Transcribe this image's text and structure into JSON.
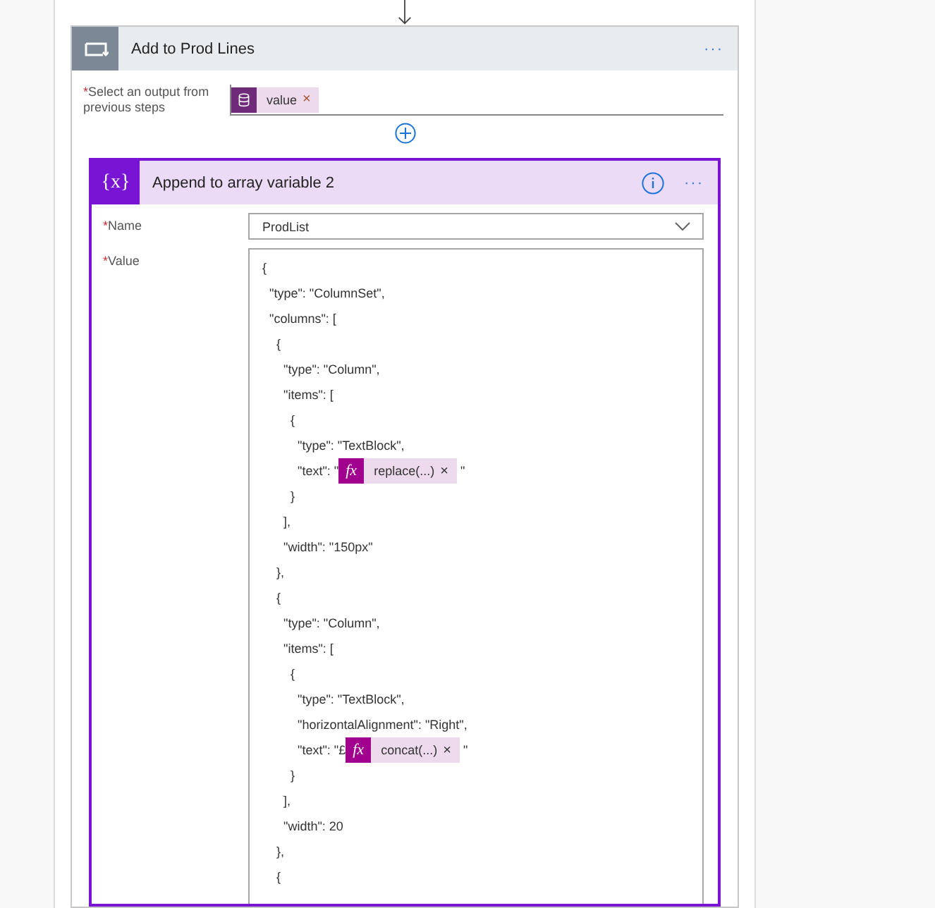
{
  "loop": {
    "title": "Add to Prod Lines",
    "more": "···",
    "field": {
      "marker": "*",
      "label": "Select an output from previous steps",
      "token": {
        "label": "value",
        "close": "×"
      }
    }
  },
  "action": {
    "icon_text": "{x}",
    "title": "Append to array variable 2",
    "more": "···",
    "fields": [
      {
        "kind": "dropdown",
        "marker": "*",
        "label": "Name",
        "value": "ProdList"
      },
      {
        "kind": "code",
        "marker": "*",
        "label": "Value"
      }
    ],
    "code_lines": [
      {
        "segments": [
          {
            "kind": "text",
            "text": "{"
          }
        ]
      },
      {
        "segments": [
          {
            "kind": "text",
            "text": "  \"type\": \"ColumnSet\","
          }
        ]
      },
      {
        "segments": [
          {
            "kind": "text",
            "text": "  \"columns\": ["
          }
        ]
      },
      {
        "segments": [
          {
            "kind": "text",
            "text": "    {"
          }
        ]
      },
      {
        "segments": [
          {
            "kind": "text",
            "text": "      \"type\": \"Column\","
          }
        ]
      },
      {
        "segments": [
          {
            "kind": "text",
            "text": "      \"items\": ["
          }
        ]
      },
      {
        "segments": [
          {
            "kind": "text",
            "text": "        {"
          }
        ]
      },
      {
        "segments": [
          {
            "kind": "text",
            "text": "          \"type\": \"TextBlock\","
          }
        ]
      },
      {
        "segments": [
          {
            "kind": "text",
            "text": "          \"text\": \""
          },
          {
            "kind": "token",
            "icon_text": "fx",
            "label": "replace(...)",
            "close": "×"
          },
          {
            "kind": "text",
            "text": " \""
          }
        ]
      },
      {
        "segments": [
          {
            "kind": "text",
            "text": "        }"
          }
        ]
      },
      {
        "segments": [
          {
            "kind": "text",
            "text": "      ],"
          }
        ]
      },
      {
        "segments": [
          {
            "kind": "text",
            "text": "      \"width\": \"150px\""
          }
        ]
      },
      {
        "segments": [
          {
            "kind": "text",
            "text": "    },"
          }
        ]
      },
      {
        "segments": [
          {
            "kind": "text",
            "text": "    {"
          }
        ]
      },
      {
        "segments": [
          {
            "kind": "text",
            "text": "      \"type\": \"Column\","
          }
        ]
      },
      {
        "segments": [
          {
            "kind": "text",
            "text": "      \"items\": ["
          }
        ]
      },
      {
        "segments": [
          {
            "kind": "text",
            "text": "        {"
          }
        ]
      },
      {
        "segments": [
          {
            "kind": "text",
            "text": "          \"type\": \"TextBlock\","
          }
        ]
      },
      {
        "segments": [
          {
            "kind": "text",
            "text": "          \"horizontalAlignment\": \"Right\","
          }
        ]
      },
      {
        "segments": [
          {
            "kind": "text",
            "text": "          \"text\": \"£"
          },
          {
            "kind": "token",
            "icon_text": "fx",
            "label": "concat(...)",
            "close": "×"
          },
          {
            "kind": "text",
            "text": " \""
          }
        ]
      },
      {
        "segments": [
          {
            "kind": "text",
            "text": "        }"
          }
        ]
      },
      {
        "segments": [
          {
            "kind": "text",
            "text": "      ],"
          }
        ]
      },
      {
        "segments": [
          {
            "kind": "text",
            "text": "      \"width\": 20"
          }
        ]
      },
      {
        "segments": [
          {
            "kind": "text",
            "text": "    },"
          }
        ]
      },
      {
        "segments": [
          {
            "kind": "text",
            "text": "    {"
          }
        ]
      }
    ]
  }
}
